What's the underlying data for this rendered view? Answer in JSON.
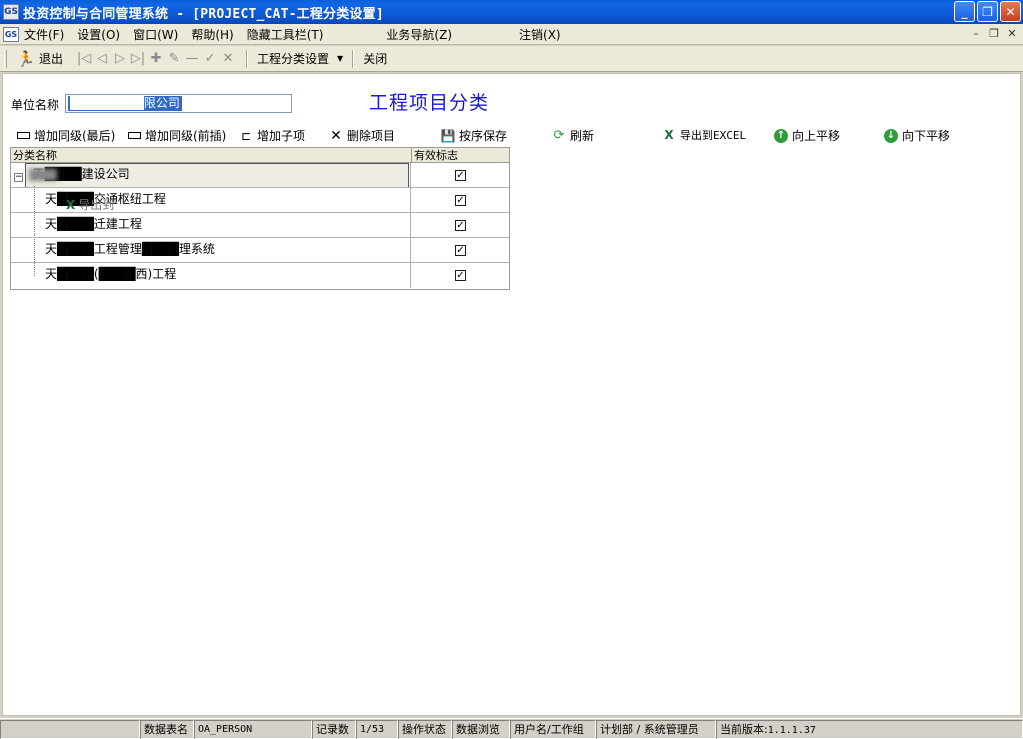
{
  "window": {
    "title": "投资控制与合同管理系统 - [PROJECT_CAT-工程分类设置]",
    "app_icon_text": "GS"
  },
  "menu": {
    "items": [
      "文件(F)",
      "设置(O)",
      "窗口(W)",
      "帮助(H)",
      "隐藏工具栏(T)",
      "业务导航(Z)",
      "注销(X)"
    ]
  },
  "toolbar": {
    "exit_label": "退出",
    "category_dropdown": "工程分类设置",
    "close_label": "关闭"
  },
  "form": {
    "unit_label": "单位名称",
    "unit_value": "████████限公司",
    "heading": "工程项目分类"
  },
  "actions": {
    "add_sibling_last": "增加同级(最后)",
    "add_sibling_before": "增加同级(前插)",
    "add_child": "增加子项",
    "delete_item": "删除项目",
    "save_order": "按序保存",
    "refresh": "刷新",
    "export_excel": "导出到EXCEL",
    "move_up": "向上平移",
    "move_down": "向下平移"
  },
  "grid": {
    "col_name": "分类名称",
    "col_flag": "有效标志",
    "rows": [
      {
        "name": "天████建设公司",
        "checked": true
      },
      {
        "name": "天████交通枢纽工程",
        "checked": true
      },
      {
        "name": "天████迁建工程",
        "checked": true
      },
      {
        "name": "天████工程管理████理系统",
        "checked": true
      },
      {
        "name": "天████(████西)工程",
        "checked": true
      }
    ],
    "ghost_export_label": "导出到"
  },
  "status": {
    "table_label": "数据表名",
    "table_value": "OA_PERSON",
    "records_label": "记录数",
    "records_value": "1/53",
    "op_label": "操作状态",
    "op_value": "数据浏览",
    "user_label": "用户名/工作组",
    "user_value": "计划部 / 系统管理员",
    "version_label": "当前版本:",
    "version_value": "1.1.1.37"
  }
}
